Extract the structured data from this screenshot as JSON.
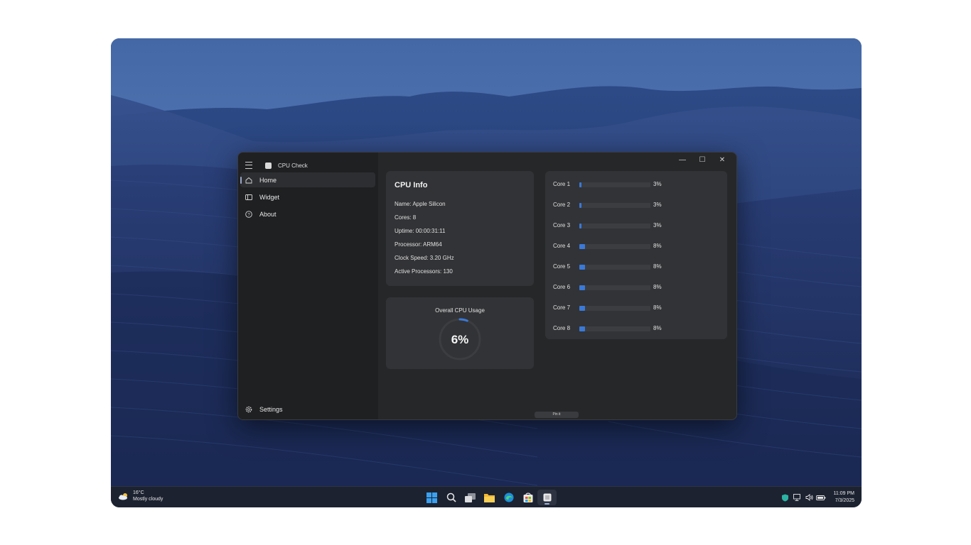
{
  "window": {
    "title": "CPU Check",
    "controls": {
      "minimize": "—",
      "maximize": "☐",
      "close": "✕"
    }
  },
  "nav": {
    "items": [
      {
        "label": "Home",
        "icon": "home-icon",
        "active": true
      },
      {
        "label": "Widget",
        "icon": "widget-icon",
        "active": false
      },
      {
        "label": "About",
        "icon": "help-icon",
        "active": false
      }
    ],
    "settings_label": "Settings"
  },
  "cpu_info": {
    "title": "CPU Info",
    "lines": [
      "Name: Apple Silicon",
      "Cores: 8",
      "Uptime: 00:00:31:11",
      "Processor: ARM64",
      "Clock Speed: 3.20 GHz",
      "Active Processors: 130"
    ]
  },
  "overall_usage": {
    "label": "Overall CPU Usage",
    "value_text": "6%",
    "value": 6
  },
  "cores": [
    {
      "label": "Core 1",
      "pct_text": "3%",
      "value": 3
    },
    {
      "label": "Core 2",
      "pct_text": "3%",
      "value": 3
    },
    {
      "label": "Core 3",
      "pct_text": "3%",
      "value": 3
    },
    {
      "label": "Core 4",
      "pct_text": "8%",
      "value": 8
    },
    {
      "label": "Core 5",
      "pct_text": "8%",
      "value": 8
    },
    {
      "label": "Core 6",
      "pct_text": "8%",
      "value": 8
    },
    {
      "label": "Core 7",
      "pct_text": "8%",
      "value": 8
    },
    {
      "label": "Core 8",
      "pct_text": "8%",
      "value": 8
    }
  ],
  "pin_button_label": "Pin it",
  "taskbar": {
    "weather": {
      "temp": "16°C",
      "condition": "Mostly cloudy"
    },
    "apps": [
      "start-icon",
      "search-icon",
      "task-view-icon",
      "file-explorer-icon",
      "edge-icon",
      "store-icon",
      "cpu-check-app-icon"
    ],
    "clock": {
      "time": "11:09 PM",
      "date": "7/3/2025"
    }
  },
  "colors": {
    "accent": "#3a79d8",
    "card": "#323336",
    "nav": "#1f2022",
    "window": "#262729",
    "taskbar": "#1c2230"
  }
}
